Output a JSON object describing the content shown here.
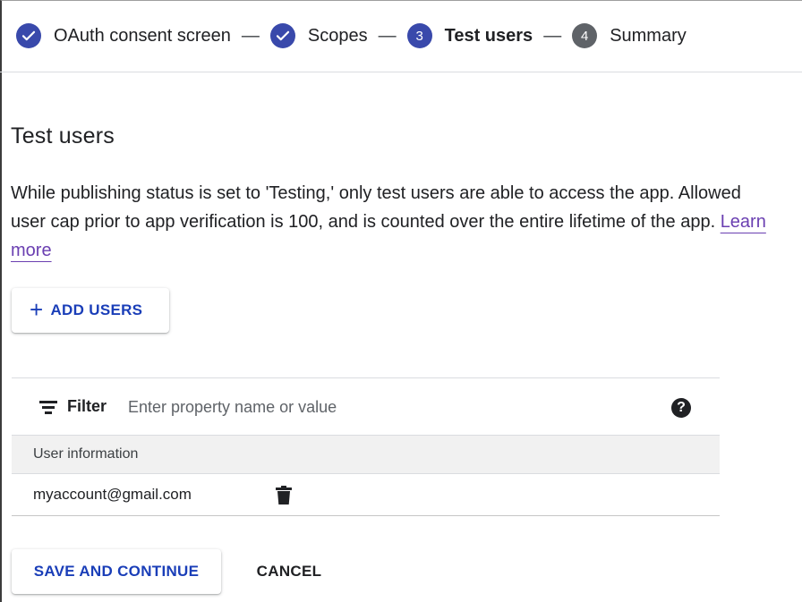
{
  "stepper": {
    "steps": [
      {
        "label": "OAuth consent screen",
        "state": "done",
        "icon": "check-icon"
      },
      {
        "label": "Scopes",
        "state": "done",
        "icon": "check-icon"
      },
      {
        "number": "3",
        "label": "Test users",
        "state": "current"
      },
      {
        "number": "4",
        "label": "Summary",
        "state": "upcoming"
      }
    ],
    "separator": "—"
  },
  "section": {
    "title": "Test users",
    "description": "While publishing status is set to 'Testing,' only test users are able to access the app. Allowed user cap prior to app verification is 100, and is counted over the entire lifetime of the app.",
    "learn_more": "Learn more"
  },
  "add_users": {
    "plus": "+",
    "label": "ADD USERS"
  },
  "filter": {
    "icon": "filter-icon",
    "label": "Filter",
    "placeholder": "Enter property name or value",
    "help": "?"
  },
  "table": {
    "header": "User information",
    "rows": [
      {
        "email": "myaccount@gmail.com",
        "action_icon": "trash-icon"
      }
    ]
  },
  "actions": {
    "save": "SAVE AND CONTINUE",
    "cancel": "CANCEL"
  },
  "colors": {
    "accent": "#1a3eb8",
    "step_done": "#3949ab",
    "step_upcoming": "#5f6368",
    "link": "#6a3fb1"
  }
}
